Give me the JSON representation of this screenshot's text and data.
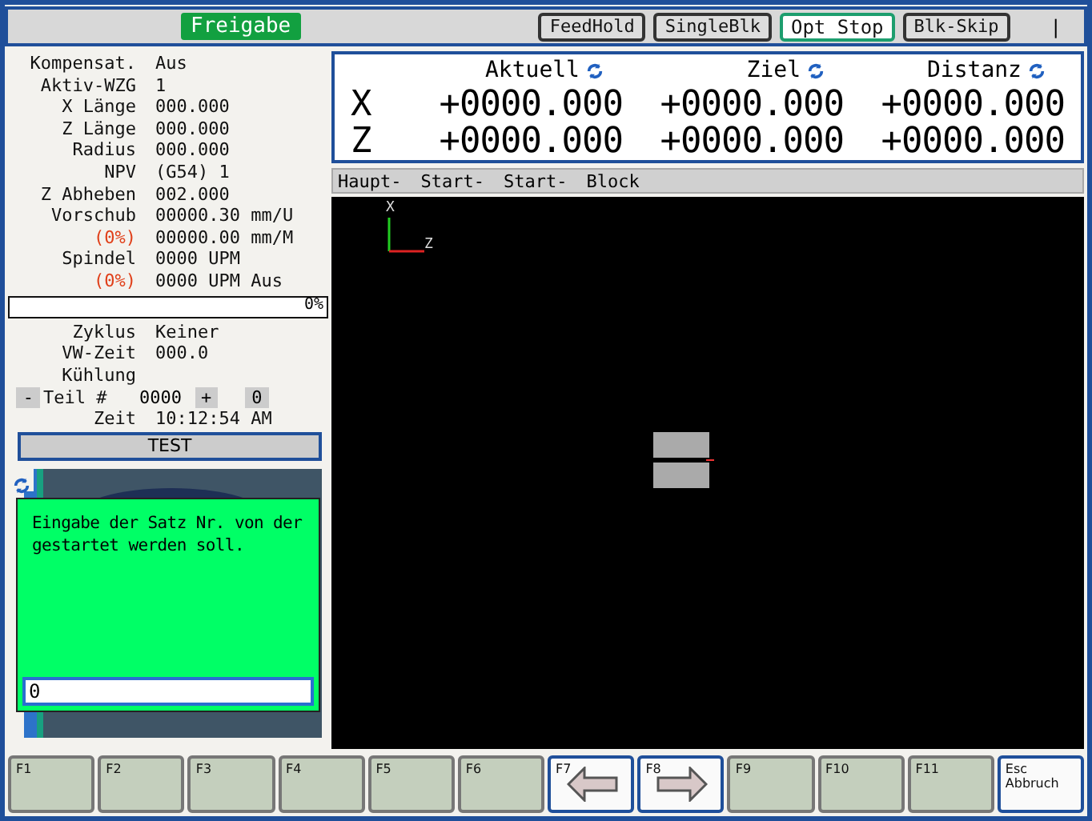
{
  "status_bar": {
    "enable": {
      "label": "Freigabe",
      "active": true
    },
    "toggles": [
      {
        "label": "FeedHold",
        "active": false
      },
      {
        "label": "SingleBlk",
        "active": false
      },
      {
        "label": "Opt Stop",
        "active": true
      },
      {
        "label": "Blk-Skip",
        "active": false
      }
    ],
    "indicator": "|"
  },
  "info": {
    "rows": [
      {
        "label": "Kompensat.",
        "value": "Aus",
        "warn": false
      },
      {
        "label": "Aktiv-WZG",
        "value": "1",
        "warn": false
      },
      {
        "label": "X Länge",
        "value": "000.000",
        "warn": false
      },
      {
        "label": "Z Länge",
        "value": "000.000",
        "warn": false
      },
      {
        "label": "Radius",
        "value": "000.000",
        "warn": false
      },
      {
        "label": "NPV",
        "value": "(G54) 1",
        "warn": false
      },
      {
        "label": "Z Abheben",
        "value": "002.000",
        "warn": false
      },
      {
        "label": "Vorschub",
        "value": "00000.30 mm/U",
        "warn": false
      },
      {
        "label": "(0%)",
        "value": "00000.00 mm/M",
        "warn": true
      },
      {
        "label": "Spindel",
        "value": "0000 UPM",
        "warn": false
      },
      {
        "label": "(0%)",
        "value": "0000 UPM Aus",
        "warn": true
      }
    ],
    "progress": {
      "level": 0,
      "reading": "0%"
    },
    "rows2": [
      {
        "label": "Zyklus",
        "value": "Keiner"
      },
      {
        "label": "VW-Zeit",
        "value": "000.0"
      },
      {
        "label": "Kühlung"
      }
    ],
    "part": {
      "minus": "-",
      "label": "Teil #",
      "value": "0000",
      "plus": "+",
      "count": "0"
    },
    "time": {
      "label": "Zeit",
      "value": "10:12:54 AM"
    },
    "mode": "TEST"
  },
  "dialog": {
    "message": "Eingabe der Satz Nr. von der gestartet werden soll.",
    "value": "0"
  },
  "dro": {
    "columns": [
      "Aktuell",
      "Ziel",
      "Distanz"
    ],
    "axes": [
      {
        "axis": "X",
        "values": [
          "+0000.000",
          "+0000.000",
          "+0000.000"
        ]
      },
      {
        "axis": "Z",
        "values": [
          "+0000.000",
          "+0000.000",
          "+0000.000"
        ]
      }
    ]
  },
  "breadcrumb": [
    "Haupt-",
    "Start-",
    "Start-",
    "Block"
  ],
  "view": {
    "x_axis": "X",
    "z_axis": "Z"
  },
  "keys": [
    {
      "label": "F1",
      "enabled": false,
      "kind": "plain"
    },
    {
      "label": "F2",
      "enabled": false,
      "kind": "plain"
    },
    {
      "label": "F3",
      "enabled": false,
      "kind": "plain"
    },
    {
      "label": "F4",
      "enabled": false,
      "kind": "plain"
    },
    {
      "label": "F5",
      "enabled": false,
      "kind": "plain"
    },
    {
      "label": "F6",
      "enabled": false,
      "kind": "plain"
    },
    {
      "label": "F7",
      "enabled": true,
      "kind": "left"
    },
    {
      "label": "F8",
      "enabled": true,
      "kind": "right"
    },
    {
      "label": "F9",
      "enabled": false,
      "kind": "plain"
    },
    {
      "label": "F10",
      "enabled": false,
      "kind": "plain"
    },
    {
      "label": "F11",
      "enabled": false,
      "kind": "plain"
    },
    {
      "label": "Esc Abbruch",
      "enabled": true,
      "kind": "plain"
    }
  ]
}
